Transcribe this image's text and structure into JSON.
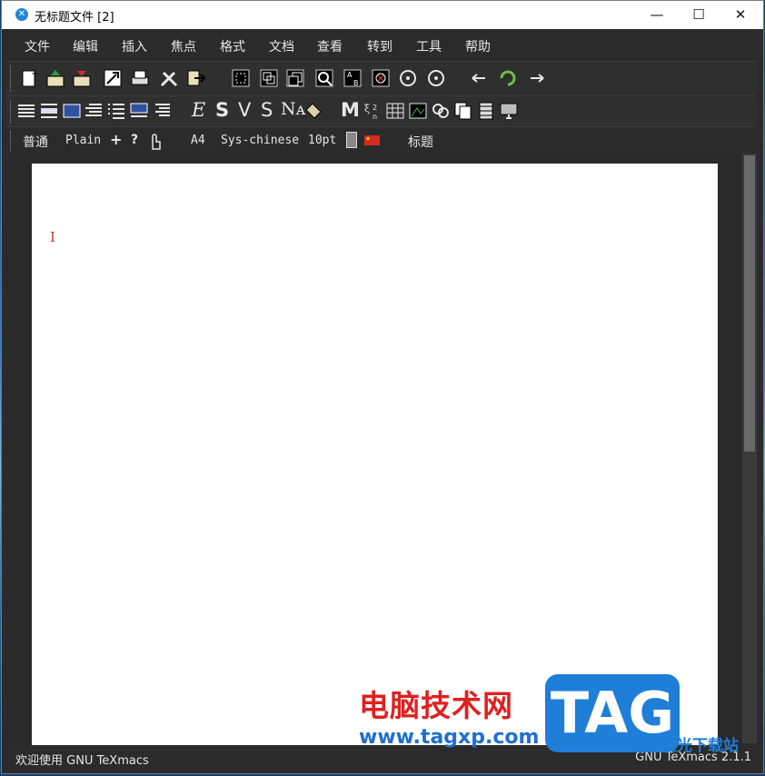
{
  "window": {
    "title": "无标题文件 [2]",
    "minimize": "—",
    "maximize": "☐",
    "close": "✕"
  },
  "menu": [
    "文件",
    "编辑",
    "插入",
    "焦点",
    "格式",
    "文档",
    "查看",
    "转到",
    "工具",
    "帮助"
  ],
  "toolbar3": {
    "style": "普通",
    "font": "Plain",
    "plus": "+",
    "question": "?",
    "paper": "A4",
    "language": "Sys-chinese",
    "size": "10pt",
    "heading": "标题"
  },
  "toolbar2_glyphs": {
    "e": "E",
    "s": "S",
    "v": "V",
    "s2": "S",
    "na": "Nᴀ",
    "m": "M"
  },
  "editor": {
    "cursor": "I"
  },
  "status": {
    "left": "欢迎使用 GNU TeXmacs",
    "right": "GNU TeXmacs 2.1.1"
  },
  "watermark": {
    "cn": "电脑技术网",
    "url": "www.tagxp.com",
    "tag": "TAG",
    "site": "极光下载站"
  },
  "colors": {
    "cursor": "#c0392b",
    "watermark_red": "#e02020",
    "watermark_blue": "#1e7ed8"
  }
}
